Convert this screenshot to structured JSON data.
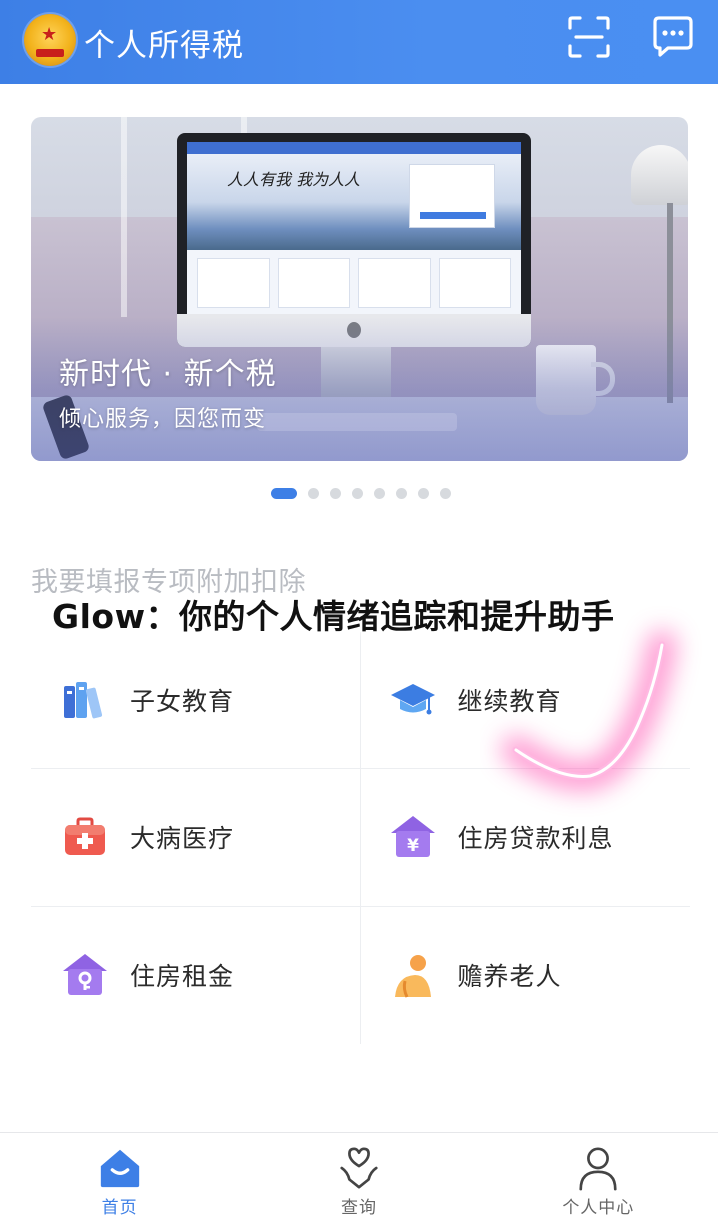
{
  "header": {
    "app_title": "个人所得税",
    "emblem_icon": "national-tax-emblem",
    "scan_icon": "scan-icon",
    "message_icon": "message-icon"
  },
  "banner": {
    "title": "新时代 · 新个税",
    "subtitle": "倾心服务，因您而变",
    "screen_slogan": "人人有我 我为人人",
    "slide_count": 8,
    "active_slide": 1
  },
  "section": {
    "title": "我要填报专项附加扣除"
  },
  "overlay": {
    "caption": "Glow：你的个人情绪追踪和提升助手"
  },
  "deductions": [
    {
      "label": "子女教育",
      "icon": "books-icon"
    },
    {
      "label": "继续教育",
      "icon": "graduation-cap-icon"
    },
    {
      "label": "大病医疗",
      "icon": "medical-kit-icon"
    },
    {
      "label": "住房贷款利息",
      "icon": "house-yuan-icon"
    },
    {
      "label": "住房租金",
      "icon": "house-key-icon"
    },
    {
      "label": "赡养老人",
      "icon": "elderly-person-icon"
    }
  ],
  "tabs": [
    {
      "label": "首页",
      "icon": "home-icon",
      "active": true
    },
    {
      "label": "查询",
      "icon": "heart-hand-icon",
      "active": false
    },
    {
      "label": "个人中心",
      "icon": "user-icon",
      "active": false
    }
  ],
  "colors": {
    "brand_blue": "#3d7fe6",
    "tab_active": "#3d7fe6",
    "tab_inactive": "#666666",
    "section_title": "#b9bcc2",
    "checkmark_glow": "#ff5fb8"
  }
}
